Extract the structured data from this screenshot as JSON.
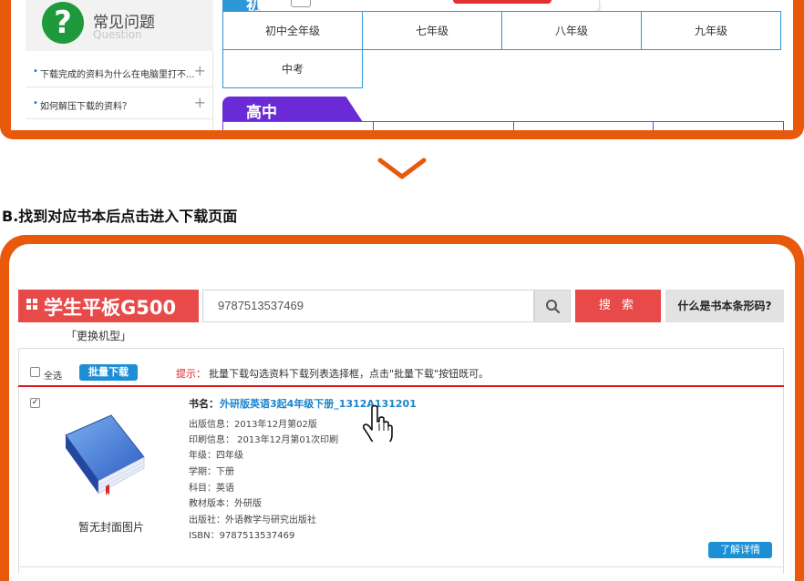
{
  "faq": {
    "title": "常见问题",
    "subtitle": "Question",
    "items": [
      {
        "text": "下载完成的资料为什么在电脑里打不..."
      },
      {
        "text": "如何解压下载的资料？"
      }
    ]
  },
  "grades": {
    "junior_tab": "初中",
    "junior": [
      "初中全年级",
      "七年级",
      "八年级",
      "九年级",
      "中考"
    ],
    "senior_tab": "高中"
  },
  "step_b": "B.找到对应书本后点击进入下载页面",
  "model": {
    "title": "学生平板G500",
    "change_label": "「更换机型」"
  },
  "search": {
    "value": "9787513537469",
    "button_label": "搜 索",
    "barcode_label": "什么是书本条形码?"
  },
  "list": {
    "select_all": "全选",
    "batch_download": "批量下载",
    "tip_label": "提示：",
    "tip_text": "批量下载勾选资料下载列表选择框，点击\"批量下载\"按钮既可。",
    "item": {
      "checked": "✓",
      "no_cover": "暂无封面图片",
      "name_label": "书名：",
      "name": "外研版英语3起4年级下册_1312A131201",
      "meta": [
        "出版信息：2013年12月第02版",
        "印刷信息： 2013年12月第01次印刷",
        "年级：四年级",
        "学期：下册",
        "科目：英语",
        "教材版本：外研版",
        "出版社：外语教学与研究出版社",
        "ISBN：9787513537469"
      ],
      "detail_button": "了解详情"
    }
  },
  "colors": {
    "orange": "#e8590c",
    "blue": "#2d97d8",
    "purple": "#6a2bd6",
    "red": "#e84a4a",
    "green": "#1e9a3c"
  }
}
